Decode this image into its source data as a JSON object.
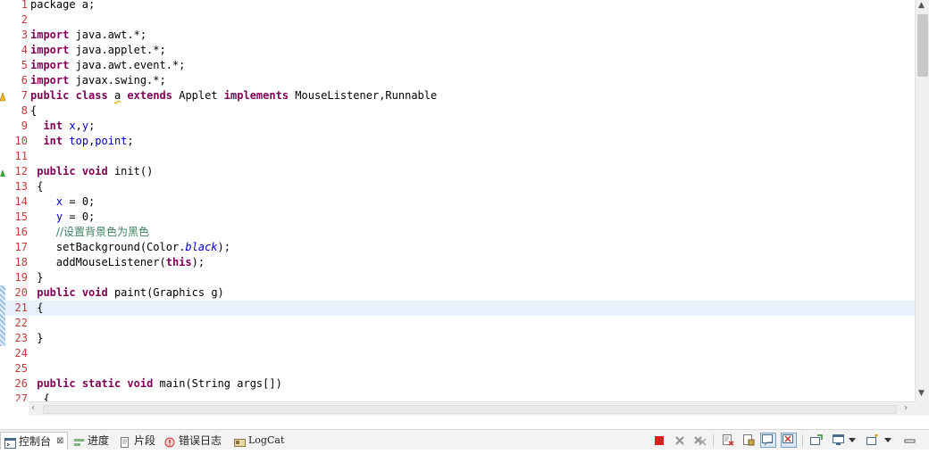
{
  "editor": {
    "lines": [
      {
        "n": "1",
        "tokens": [
          {
            "t": "package a;",
            "c": ""
          }
        ]
      },
      {
        "n": "2",
        "tokens": []
      },
      {
        "n": "3",
        "tokens": [
          {
            "t": "import",
            "c": "kw"
          },
          {
            "t": " java.awt.*;",
            "c": ""
          }
        ]
      },
      {
        "n": "4",
        "tokens": [
          {
            "t": "import",
            "c": "kw"
          },
          {
            "t": " java.applet.*;",
            "c": ""
          }
        ]
      },
      {
        "n": "5",
        "tokens": [
          {
            "t": "import",
            "c": "kw"
          },
          {
            "t": " java.awt.event.*;",
            "c": ""
          }
        ]
      },
      {
        "n": "6",
        "tokens": [
          {
            "t": "import",
            "c": "kw"
          },
          {
            "t": " javax.swing.*;",
            "c": ""
          }
        ]
      },
      {
        "n": "7",
        "marker": "warning",
        "tokens": [
          {
            "t": "public",
            "c": "kw"
          },
          {
            "t": " ",
            "c": ""
          },
          {
            "t": "class",
            "c": "kw"
          },
          {
            "t": " ",
            "c": ""
          },
          {
            "t": "a",
            "c": "cls-warn"
          },
          {
            "t": " ",
            "c": ""
          },
          {
            "t": "extends",
            "c": "kw"
          },
          {
            "t": " Applet ",
            "c": ""
          },
          {
            "t": "implements",
            "c": "kw"
          },
          {
            "t": " MouseListener,Runnable",
            "c": ""
          }
        ]
      },
      {
        "n": "8",
        "tokens": [
          {
            "t": "{",
            "c": ""
          }
        ]
      },
      {
        "n": "9",
        "tokens": [
          {
            "t": "  ",
            "c": ""
          },
          {
            "t": "int",
            "c": "kw"
          },
          {
            "t": " ",
            "c": ""
          },
          {
            "t": "x",
            "c": "fld"
          },
          {
            "t": ",",
            "c": ""
          },
          {
            "t": "y",
            "c": "fld"
          },
          {
            "t": ";",
            "c": ""
          }
        ]
      },
      {
        "n": "10",
        "tokens": [
          {
            "t": "  ",
            "c": ""
          },
          {
            "t": "int",
            "c": "kw"
          },
          {
            "t": " ",
            "c": ""
          },
          {
            "t": "top",
            "c": "fld"
          },
          {
            "t": ",",
            "c": ""
          },
          {
            "t": "point",
            "c": "fld"
          },
          {
            "t": ";",
            "c": ""
          }
        ]
      },
      {
        "n": "11",
        "tokens": []
      },
      {
        "n": "12",
        "marker": "override",
        "tokens": [
          {
            "t": " ",
            "c": ""
          },
          {
            "t": "public",
            "c": "kw"
          },
          {
            "t": " ",
            "c": ""
          },
          {
            "t": "void",
            "c": "kw"
          },
          {
            "t": " init()",
            "c": ""
          }
        ]
      },
      {
        "n": "13",
        "tokens": [
          {
            "t": " {",
            "c": ""
          }
        ]
      },
      {
        "n": "14",
        "tokens": [
          {
            "t": "    ",
            "c": ""
          },
          {
            "t": "x",
            "c": "fld"
          },
          {
            "t": " = 0;",
            "c": ""
          }
        ]
      },
      {
        "n": "15",
        "tokens": [
          {
            "t": "    ",
            "c": ""
          },
          {
            "t": "y",
            "c": "fld"
          },
          {
            "t": " = 0;",
            "c": ""
          }
        ]
      },
      {
        "n": "16",
        "tokens": [
          {
            "t": "    ",
            "c": ""
          },
          {
            "t": "//设置背景色为黑色",
            "c": "cmt"
          }
        ]
      },
      {
        "n": "17",
        "tokens": [
          {
            "t": "    setBackground(Color.",
            "c": ""
          },
          {
            "t": "black",
            "c": "sfld"
          },
          {
            "t": ");",
            "c": ""
          }
        ]
      },
      {
        "n": "18",
        "tokens": [
          {
            "t": "    addMouseListener(",
            "c": ""
          },
          {
            "t": "this",
            "c": "kw"
          },
          {
            "t": ");",
            "c": ""
          }
        ]
      },
      {
        "n": "19",
        "tokens": [
          {
            "t": " }",
            "c": ""
          }
        ]
      },
      {
        "n": "20",
        "marker": "change",
        "tokens": [
          {
            "t": " ",
            "c": ""
          },
          {
            "t": "public",
            "c": "kw"
          },
          {
            "t": " ",
            "c": ""
          },
          {
            "t": "void",
            "c": "kw"
          },
          {
            "t": " paint(Graphics g)",
            "c": ""
          }
        ]
      },
      {
        "n": "21",
        "marker": "change",
        "current": true,
        "tokens": [
          {
            "t": " {",
            "c": ""
          }
        ]
      },
      {
        "n": "22",
        "marker": "change",
        "tokens": []
      },
      {
        "n": "23",
        "marker": "change",
        "tokens": [
          {
            "t": " }",
            "c": ""
          }
        ]
      },
      {
        "n": "24",
        "tokens": []
      },
      {
        "n": "25",
        "tokens": []
      },
      {
        "n": "26",
        "tokens": [
          {
            "t": " ",
            "c": ""
          },
          {
            "t": "public",
            "c": "kw"
          },
          {
            "t": " ",
            "c": ""
          },
          {
            "t": "static",
            "c": "kw"
          },
          {
            "t": " ",
            "c": ""
          },
          {
            "t": "void",
            "c": "kw"
          },
          {
            "t": " main(String args[])",
            "c": ""
          }
        ]
      },
      {
        "n": "27",
        "tokens": [
          {
            "t": "  {",
            "c": ""
          }
        ]
      }
    ]
  },
  "panel": {
    "tabs": [
      {
        "id": "console",
        "label": "控制台",
        "icon": "console-icon",
        "active": true
      },
      {
        "id": "progress",
        "label": "进度",
        "icon": "progress-icon"
      },
      {
        "id": "snippets",
        "label": "片段",
        "icon": "snippets-icon"
      },
      {
        "id": "errorlog",
        "label": "错误日志",
        "icon": "error-log-icon"
      },
      {
        "id": "logcat",
        "label": "LogCat",
        "icon": "logcat-icon"
      }
    ],
    "close_glyph": "⊠",
    "toolbar": [
      "terminate-icon",
      "remove-launch-icon",
      "remove-all-icon",
      "clear-console-icon",
      "scroll-lock-icon",
      "show-on-stdout-icon",
      "show-on-stderr-icon",
      "pin-console-icon",
      "display-console-icon",
      "open-console-icon",
      "minimize-icon"
    ]
  },
  "colors": {
    "keyword": "#7f0055",
    "field": "#0000c0",
    "comment": "#3f7f5f",
    "line_number": "#c23b3b",
    "current_line": "#e8f2fe"
  }
}
